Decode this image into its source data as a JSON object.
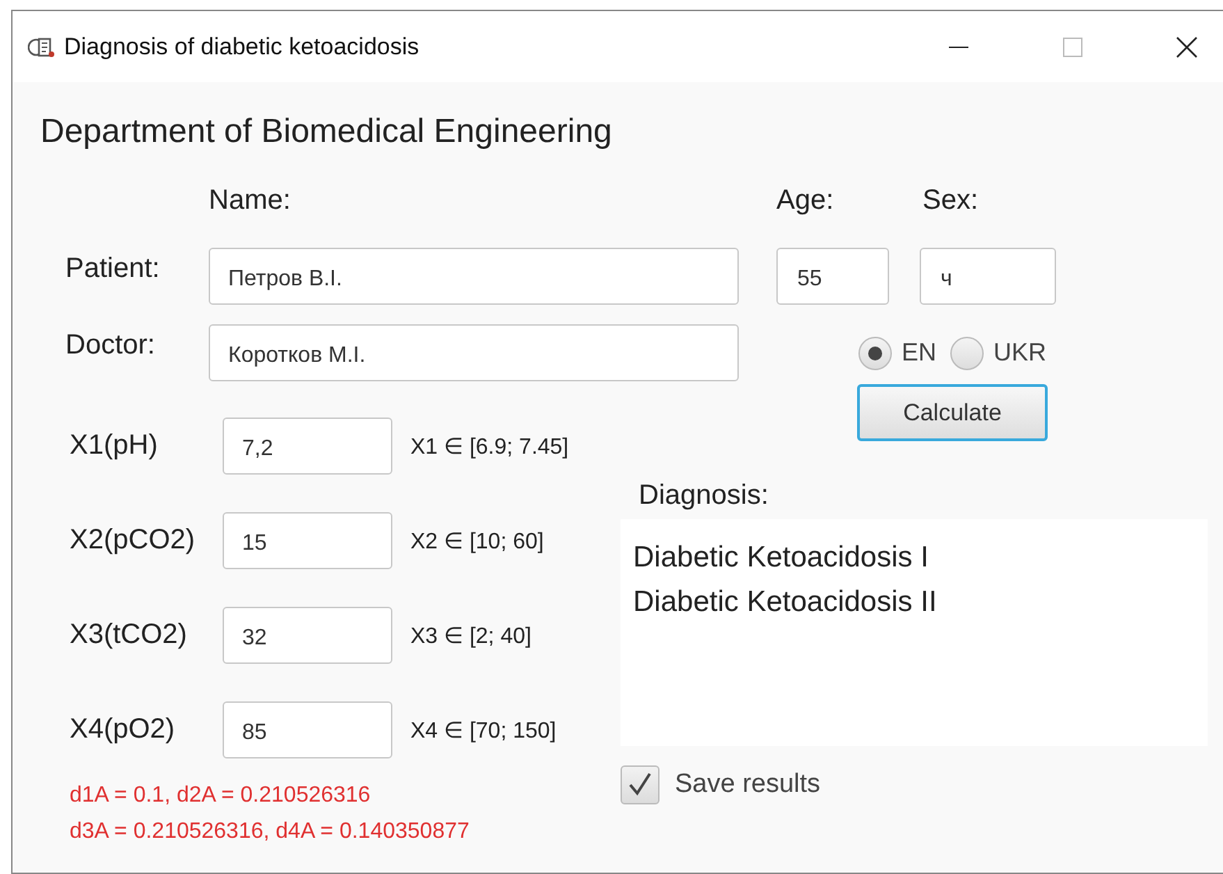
{
  "window": {
    "title": "Diagnosis of diabetic ketoacidosis"
  },
  "heading": "Department of Biomedical Engineering",
  "columns": {
    "name": "Name:",
    "age": "Age:",
    "sex": "Sex:"
  },
  "people": [
    {
      "label": "Patient:",
      "name": "Петров В.І.",
      "age": "55",
      "sex": "ч"
    },
    {
      "label": "Doctor:",
      "name": "Коротков М.І."
    }
  ],
  "language": [
    {
      "label": "EN",
      "selected": true
    },
    {
      "label": "UKR",
      "selected": false
    }
  ],
  "calculate_button": "Calculate",
  "variables": [
    {
      "label": "X1(pH)",
      "value": "7,2",
      "range": "X1 ∈ [6.9; 7.45]"
    },
    {
      "label": "X2(pCO2)",
      "value": "15",
      "range": "X2 ∈ [10; 60]"
    },
    {
      "label": "X3(tCO2)",
      "value": "32",
      "range": "X3 ∈ [2; 40]"
    },
    {
      "label": "X4(pO2)",
      "value": "85",
      "range": "X4 ∈ [70; 150]"
    }
  ],
  "results": [
    "d1A = 0.1, d2A = 0.210526316",
    "d3A = 0.210526316, d4A = 0.140350877"
  ],
  "diagnosis": {
    "label": "Diagnosis:",
    "lines": [
      "Diabetic Ketoacidosis I",
      "Diabetic Ketoacidosis II"
    ]
  },
  "save_results": {
    "label": "Save results",
    "checked": true
  }
}
